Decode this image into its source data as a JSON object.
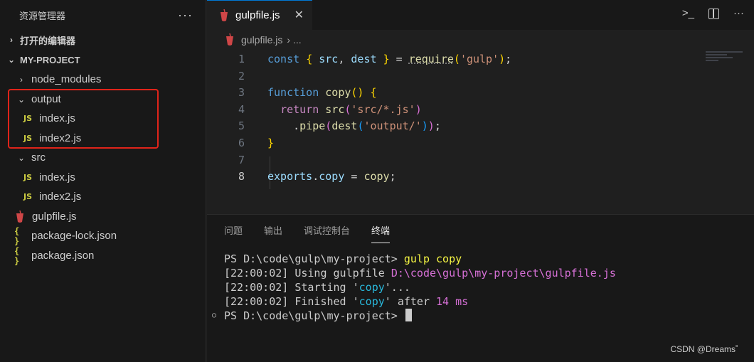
{
  "sidebar": {
    "title": "资源管理器",
    "more": "···",
    "open_editors": "打开的编辑器",
    "project": "MY-PROJECT",
    "tree": [
      {
        "label": "node_modules",
        "type": "folder",
        "expanded": false
      },
      {
        "label": "output",
        "type": "folder",
        "expanded": true
      },
      {
        "label": "index.js",
        "type": "js"
      },
      {
        "label": "index2.js",
        "type": "js"
      },
      {
        "label": "src",
        "type": "folder",
        "expanded": true
      },
      {
        "label": "index.js",
        "type": "js"
      },
      {
        "label": "index2.js",
        "type": "js"
      },
      {
        "label": "gulpfile.js",
        "type": "gulp"
      },
      {
        "label": "package-lock.json",
        "type": "json"
      },
      {
        "label": "package.json",
        "type": "json"
      }
    ],
    "js_badge": "JS",
    "json_badge": "{ }"
  },
  "tab": {
    "label": "gulpfile.js",
    "close": "✕"
  },
  "breadcrumb": {
    "file": "gulpfile.js",
    "rest": "› ..."
  },
  "editor": {
    "line_numbers": [
      "1",
      "2",
      "3",
      "4",
      "5",
      "6",
      "7",
      "8"
    ],
    "active_line": "8"
  },
  "panel": {
    "tabs": [
      "问题",
      "输出",
      "调试控制台",
      "终端"
    ],
    "active_tab": "终端",
    "terminal": {
      "prompt1": "PS D:\\code\\gulp\\my-project> ",
      "cmd": "gulp copy",
      "l2_time": "[22:00:02]",
      "l2_text": " Using gulpfile ",
      "l2_path": "D:\\code\\gulp\\my-project\\gulpfile.js",
      "l3_time": "[22:00:02]",
      "l3_text": " Starting '",
      "l3_task": "copy",
      "l3_end": "'...",
      "l4_time": "[22:00:02]",
      "l4_text": " Finished '",
      "l4_task": "copy",
      "l4_mid": "' after ",
      "l4_dur": "14 ms",
      "prompt2": "PS D:\\code\\gulp\\my-project>"
    }
  },
  "watermark": "CSDN @Dreams゜",
  "colors": {
    "accent": "#0078d4",
    "highlight_box": "#e0241a"
  }
}
